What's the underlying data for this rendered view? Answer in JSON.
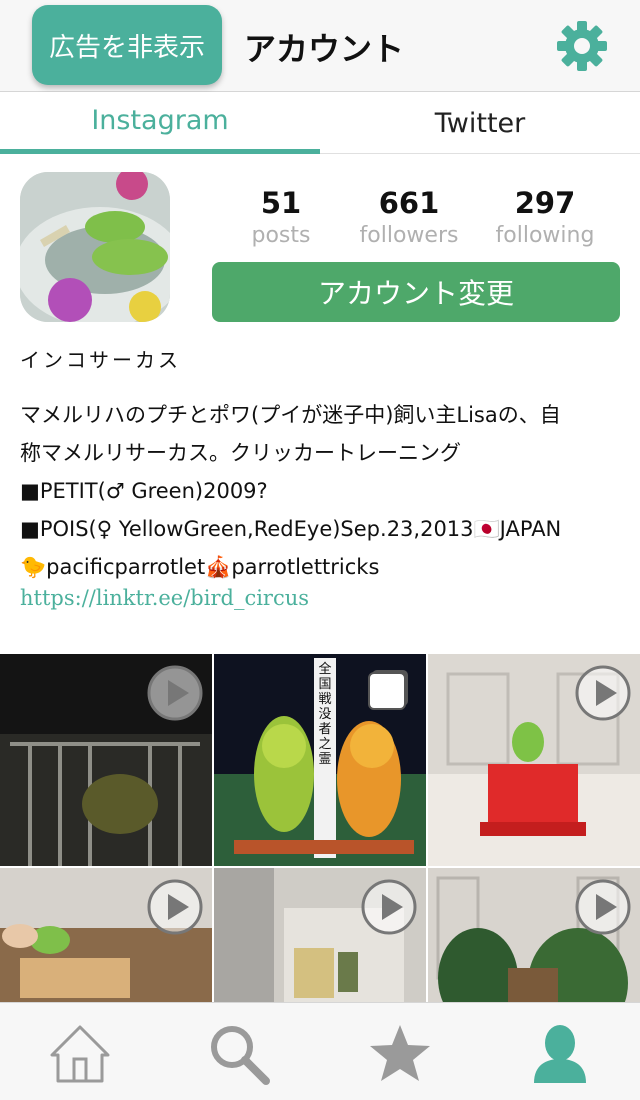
{
  "header": {
    "hide_ads_label": "広告を非表示",
    "title": "アカウント",
    "settings_icon": "gear-icon"
  },
  "tabs": [
    {
      "label": "Instagram",
      "active": true
    },
    {
      "label": "Twitter",
      "active": false
    }
  ],
  "profile": {
    "stats": [
      {
        "value": "51",
        "label": "posts"
      },
      {
        "value": "661",
        "label": "followers"
      },
      {
        "value": "297",
        "label": "following"
      }
    ],
    "change_account_label": "アカウント変更",
    "username": "インコサーカス",
    "bio_lines": [
      "マメルリハのプチとポワ(プイが迷子中)飼い主Lisaの、自",
      "称マメルリサーカス。クリッカートレーニング",
      "■PETIT(♂ Green)2009?",
      "■POIS(♀ YellowGreen,RedEye)Sep.23,2013🇯🇵JAPAN",
      "🐤pacificparrotlet🎪parrotlettricks"
    ],
    "link": "https://linktr.ee/bird_circus"
  },
  "grid": {
    "items": [
      {
        "type": "video"
      },
      {
        "type": "gallery",
        "sign_text": "全国戦没者之霊"
      },
      {
        "type": "video"
      },
      {
        "type": "video"
      },
      {
        "type": "video"
      },
      {
        "type": "video"
      }
    ]
  },
  "colors": {
    "accent": "#4bb09c",
    "button_green": "#4ea86a",
    "nav_active": "#4bb09c",
    "nav_inactive": "#9a9a9a"
  },
  "bottom_nav": [
    {
      "icon": "home-icon",
      "active": false
    },
    {
      "icon": "search-icon",
      "active": false
    },
    {
      "icon": "star-icon",
      "active": false
    },
    {
      "icon": "user-icon",
      "active": true
    }
  ]
}
